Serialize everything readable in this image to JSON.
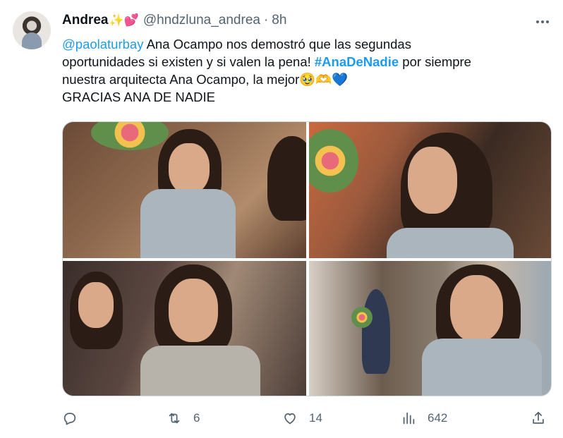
{
  "tweet": {
    "display_name": "Andrea",
    "name_emojis": "✨💕",
    "handle": "@hndzluna_andrea",
    "separator": "·",
    "time": "8h",
    "text": {
      "mention": "@paolaturbay",
      "line1_rest": " Ana Ocampo nos demostró que las segundas",
      "line2_start": "oportunidades si existen y si valen la pena! ",
      "hashtag": "#AnaDeNadie",
      "line2_end": " por siempre",
      "line3": "nuestra arquitecta Ana Ocampo, la mejor",
      "line3_emojis": "🥹🫶💙",
      "line4": "GRACIAS ANA DE NADIE"
    },
    "media": {
      "photos": [
        "photo-1",
        "photo-2",
        "photo-3",
        "photo-4"
      ]
    },
    "actions": {
      "reply": {
        "icon": "reply-icon",
        "count": ""
      },
      "retweet": {
        "icon": "retweet-icon",
        "count": "6"
      },
      "like": {
        "icon": "heart-icon",
        "count": "14"
      },
      "views": {
        "icon": "views-icon",
        "count": "642"
      },
      "share": {
        "icon": "share-icon",
        "count": ""
      }
    }
  },
  "colors": {
    "accent": "#1d9bf0",
    "text": "#0f1419",
    "secondary": "#536471",
    "border": "#cfd9de"
  }
}
